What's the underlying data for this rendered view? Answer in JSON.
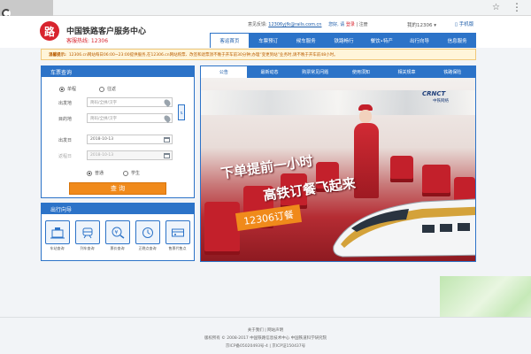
{
  "header": {
    "logo_glyph": "路",
    "title": "中国铁路客户服务中心",
    "hotline": "客服热线: 12306",
    "login_prefix": "意见反馈: ",
    "login_email": "12306yjfk@rails.com.cn",
    "login_mid": "您好, 请",
    "login_action": "登录",
    "register": "| 注册",
    "my12306": "我的12306 ▾",
    "mobile": "▯ 手机版"
  },
  "nav": {
    "items": [
      {
        "label": "客运首页",
        "active": true
      },
      {
        "label": "车票预订"
      },
      {
        "label": "候车服务"
      },
      {
        "label": "铁路畅行"
      },
      {
        "label": "餐饮•特产"
      },
      {
        "label": "出行向导"
      },
      {
        "label": "信息服务"
      }
    ]
  },
  "notice": {
    "label": "温馨提示:",
    "text": "12306.cn网站每日06:00~23:00提供服务,在12306.cn网站购票、改签和退票须不晚于开车前30分钟;办理“变更到站”业务时,请不晚于开车前48小时。"
  },
  "booking": {
    "title": "车票查询",
    "trip_types": [
      "单程",
      "往返"
    ],
    "from_label": "出发地",
    "from_placeholder": "简码/全拼/汉字",
    "to_label": "目的地",
    "to_placeholder": "简码/全拼/汉字",
    "depart_label": "出发日",
    "depart_value": "2018-10-13",
    "return_label": "返程日",
    "return_value": "2018-10-13",
    "swap": "⇅",
    "ticket_types": [
      "普通",
      "学生"
    ],
    "query_button": "查  询"
  },
  "guide": {
    "title": "出行向导",
    "items": [
      {
        "label": "车站查询",
        "icon": "station-icon"
      },
      {
        "label": "列车查询",
        "icon": "train-icon"
      },
      {
        "label": "票价查询",
        "icon": "price-icon"
      },
      {
        "label": "正晚点查询",
        "icon": "clock-icon"
      },
      {
        "label": "售票代售点",
        "icon": "ticket-icon"
      }
    ]
  },
  "news": {
    "tabs": [
      {
        "label": "公告",
        "active": true
      },
      {
        "label": "最新动态"
      },
      {
        "label": "购票常见问题"
      },
      {
        "label": "使用须知"
      },
      {
        "label": "相关规章"
      },
      {
        "label": "铁路保险"
      }
    ],
    "banner": {
      "line1": "下单提前一小时",
      "line2": "高铁订餐飞起来",
      "badge": "12306订餐",
      "brand": "CRNCT",
      "brand_sub": "中铁网络"
    }
  },
  "footer": {
    "links": "关于我们  |  网站声明",
    "copyright": "版权所有 © 2008-2017 中国铁路信息技术中心  中国铁道科学研究院",
    "icp": "京ICP备05020493号-4  |  京ICP证150437号"
  },
  "colors": {
    "brand_blue": "#2c73c8",
    "accent_orange": "#f08a1b",
    "logo_red": "#d8242e",
    "notice_bg": "#fff5d9"
  }
}
